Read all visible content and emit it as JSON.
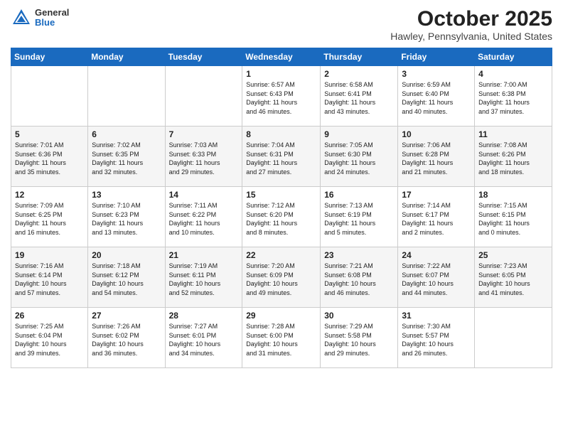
{
  "header": {
    "logo_general": "General",
    "logo_blue": "Blue",
    "month_title": "October 2025",
    "location": "Hawley, Pennsylvania, United States"
  },
  "days_of_week": [
    "Sunday",
    "Monday",
    "Tuesday",
    "Wednesday",
    "Thursday",
    "Friday",
    "Saturday"
  ],
  "weeks": [
    [
      {
        "day": "",
        "info": ""
      },
      {
        "day": "",
        "info": ""
      },
      {
        "day": "",
        "info": ""
      },
      {
        "day": "1",
        "info": "Sunrise: 6:57 AM\nSunset: 6:43 PM\nDaylight: 11 hours\nand 46 minutes."
      },
      {
        "day": "2",
        "info": "Sunrise: 6:58 AM\nSunset: 6:41 PM\nDaylight: 11 hours\nand 43 minutes."
      },
      {
        "day": "3",
        "info": "Sunrise: 6:59 AM\nSunset: 6:40 PM\nDaylight: 11 hours\nand 40 minutes."
      },
      {
        "day": "4",
        "info": "Sunrise: 7:00 AM\nSunset: 6:38 PM\nDaylight: 11 hours\nand 37 minutes."
      }
    ],
    [
      {
        "day": "5",
        "info": "Sunrise: 7:01 AM\nSunset: 6:36 PM\nDaylight: 11 hours\nand 35 minutes."
      },
      {
        "day": "6",
        "info": "Sunrise: 7:02 AM\nSunset: 6:35 PM\nDaylight: 11 hours\nand 32 minutes."
      },
      {
        "day": "7",
        "info": "Sunrise: 7:03 AM\nSunset: 6:33 PM\nDaylight: 11 hours\nand 29 minutes."
      },
      {
        "day": "8",
        "info": "Sunrise: 7:04 AM\nSunset: 6:31 PM\nDaylight: 11 hours\nand 27 minutes."
      },
      {
        "day": "9",
        "info": "Sunrise: 7:05 AM\nSunset: 6:30 PM\nDaylight: 11 hours\nand 24 minutes."
      },
      {
        "day": "10",
        "info": "Sunrise: 7:06 AM\nSunset: 6:28 PM\nDaylight: 11 hours\nand 21 minutes."
      },
      {
        "day": "11",
        "info": "Sunrise: 7:08 AM\nSunset: 6:26 PM\nDaylight: 11 hours\nand 18 minutes."
      }
    ],
    [
      {
        "day": "12",
        "info": "Sunrise: 7:09 AM\nSunset: 6:25 PM\nDaylight: 11 hours\nand 16 minutes."
      },
      {
        "day": "13",
        "info": "Sunrise: 7:10 AM\nSunset: 6:23 PM\nDaylight: 11 hours\nand 13 minutes."
      },
      {
        "day": "14",
        "info": "Sunrise: 7:11 AM\nSunset: 6:22 PM\nDaylight: 11 hours\nand 10 minutes."
      },
      {
        "day": "15",
        "info": "Sunrise: 7:12 AM\nSunset: 6:20 PM\nDaylight: 11 hours\nand 8 minutes."
      },
      {
        "day": "16",
        "info": "Sunrise: 7:13 AM\nSunset: 6:19 PM\nDaylight: 11 hours\nand 5 minutes."
      },
      {
        "day": "17",
        "info": "Sunrise: 7:14 AM\nSunset: 6:17 PM\nDaylight: 11 hours\nand 2 minutes."
      },
      {
        "day": "18",
        "info": "Sunrise: 7:15 AM\nSunset: 6:15 PM\nDaylight: 11 hours\nand 0 minutes."
      }
    ],
    [
      {
        "day": "19",
        "info": "Sunrise: 7:16 AM\nSunset: 6:14 PM\nDaylight: 10 hours\nand 57 minutes."
      },
      {
        "day": "20",
        "info": "Sunrise: 7:18 AM\nSunset: 6:12 PM\nDaylight: 10 hours\nand 54 minutes."
      },
      {
        "day": "21",
        "info": "Sunrise: 7:19 AM\nSunset: 6:11 PM\nDaylight: 10 hours\nand 52 minutes."
      },
      {
        "day": "22",
        "info": "Sunrise: 7:20 AM\nSunset: 6:09 PM\nDaylight: 10 hours\nand 49 minutes."
      },
      {
        "day": "23",
        "info": "Sunrise: 7:21 AM\nSunset: 6:08 PM\nDaylight: 10 hours\nand 46 minutes."
      },
      {
        "day": "24",
        "info": "Sunrise: 7:22 AM\nSunset: 6:07 PM\nDaylight: 10 hours\nand 44 minutes."
      },
      {
        "day": "25",
        "info": "Sunrise: 7:23 AM\nSunset: 6:05 PM\nDaylight: 10 hours\nand 41 minutes."
      }
    ],
    [
      {
        "day": "26",
        "info": "Sunrise: 7:25 AM\nSunset: 6:04 PM\nDaylight: 10 hours\nand 39 minutes."
      },
      {
        "day": "27",
        "info": "Sunrise: 7:26 AM\nSunset: 6:02 PM\nDaylight: 10 hours\nand 36 minutes."
      },
      {
        "day": "28",
        "info": "Sunrise: 7:27 AM\nSunset: 6:01 PM\nDaylight: 10 hours\nand 34 minutes."
      },
      {
        "day": "29",
        "info": "Sunrise: 7:28 AM\nSunset: 6:00 PM\nDaylight: 10 hours\nand 31 minutes."
      },
      {
        "day": "30",
        "info": "Sunrise: 7:29 AM\nSunset: 5:58 PM\nDaylight: 10 hours\nand 29 minutes."
      },
      {
        "day": "31",
        "info": "Sunrise: 7:30 AM\nSunset: 5:57 PM\nDaylight: 10 hours\nand 26 minutes."
      },
      {
        "day": "",
        "info": ""
      }
    ]
  ]
}
